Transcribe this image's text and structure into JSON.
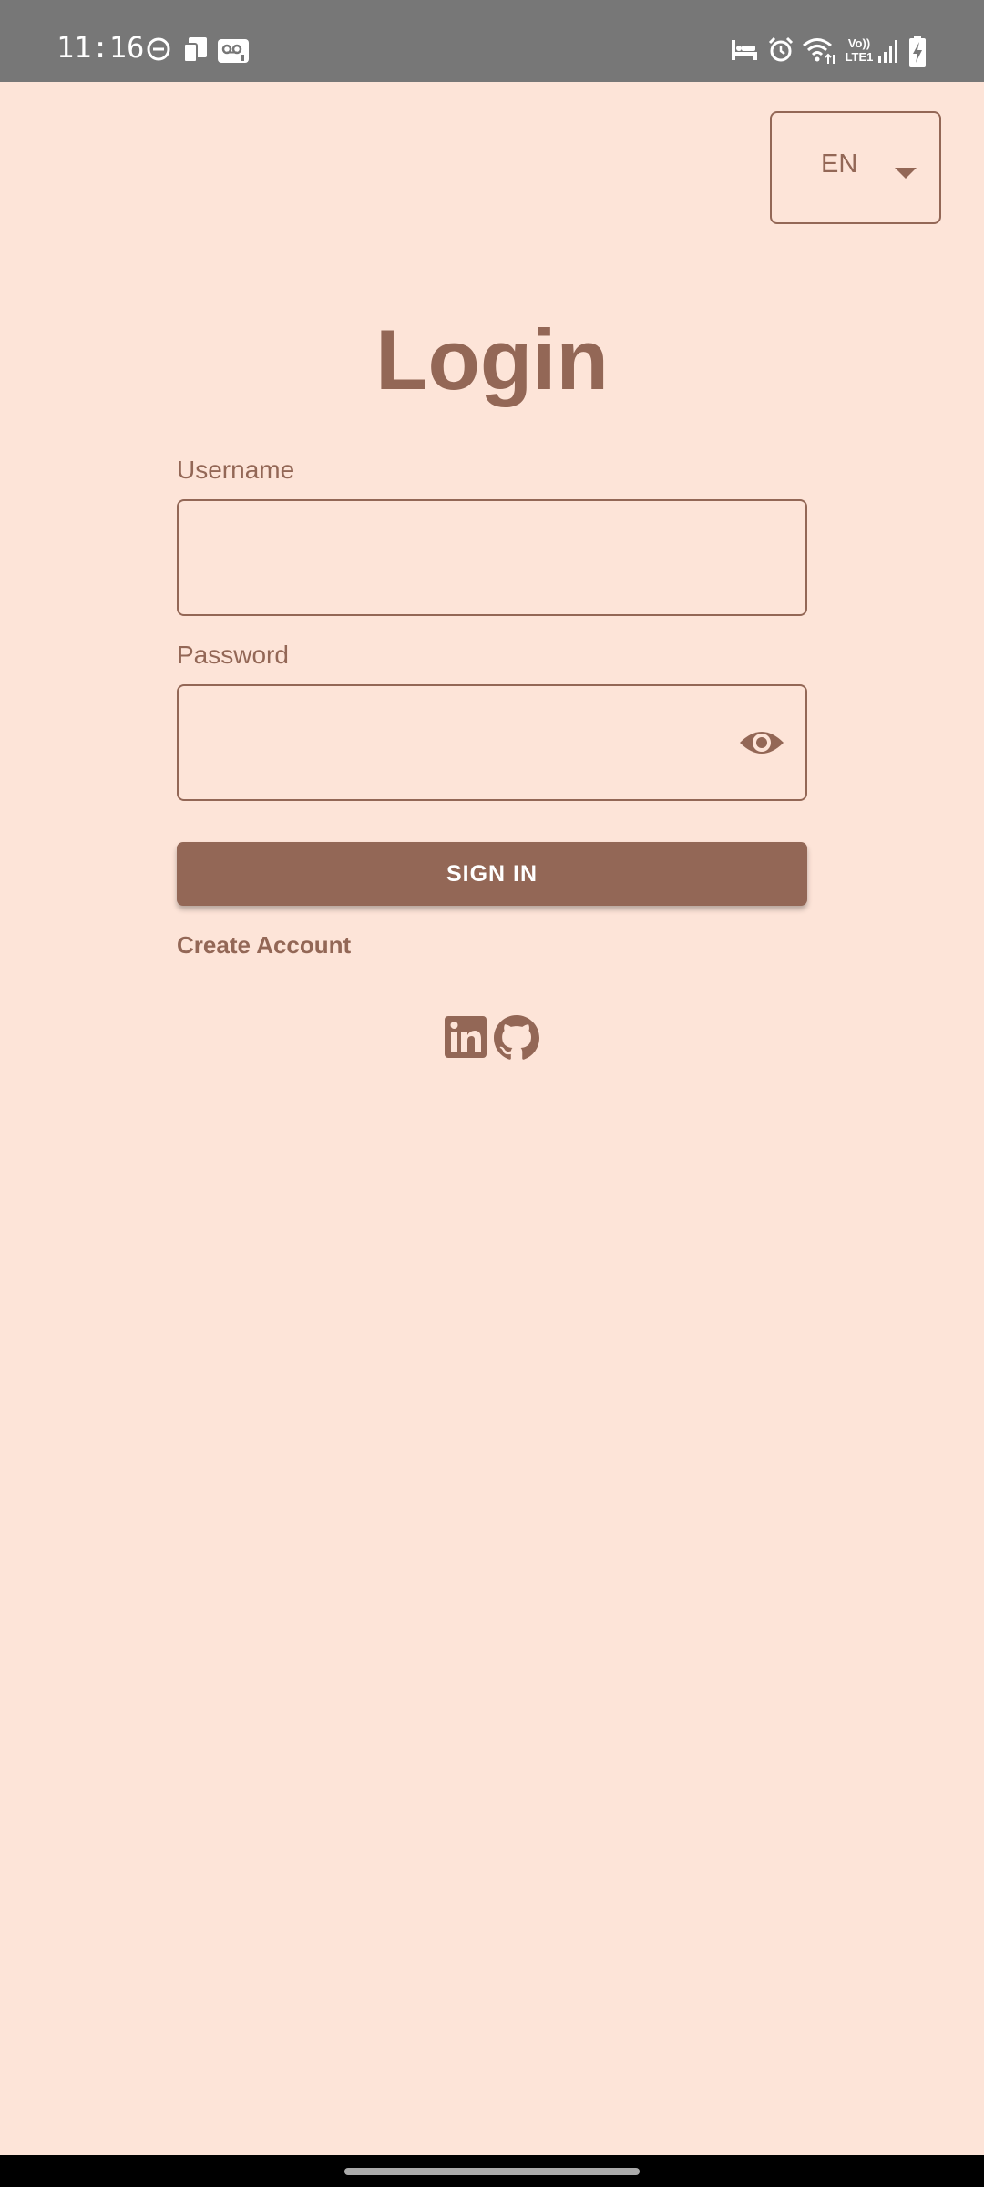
{
  "status_bar": {
    "time": "11:16",
    "icons": [
      "dnd-icon",
      "sim-card-icon",
      "voicemail-icon",
      "bed-icon",
      "alarm-icon",
      "wifi-icon",
      "volte-icon",
      "signal-icon",
      "battery-charging-icon"
    ],
    "volte_text_top": "Vo))",
    "volte_text_bottom": "LTE1"
  },
  "language_selector": {
    "value": "EN"
  },
  "login": {
    "title": "Login",
    "username_label": "Username",
    "username_value": "",
    "password_label": "Password",
    "password_value": "",
    "sign_in_label": "SIGN IN",
    "create_account_label": "Create Account"
  },
  "social_links": [
    "linkedin-icon",
    "github-icon"
  ],
  "colors": {
    "background": "#fde4d8",
    "accent": "#936756",
    "status_bar": "#777777"
  }
}
